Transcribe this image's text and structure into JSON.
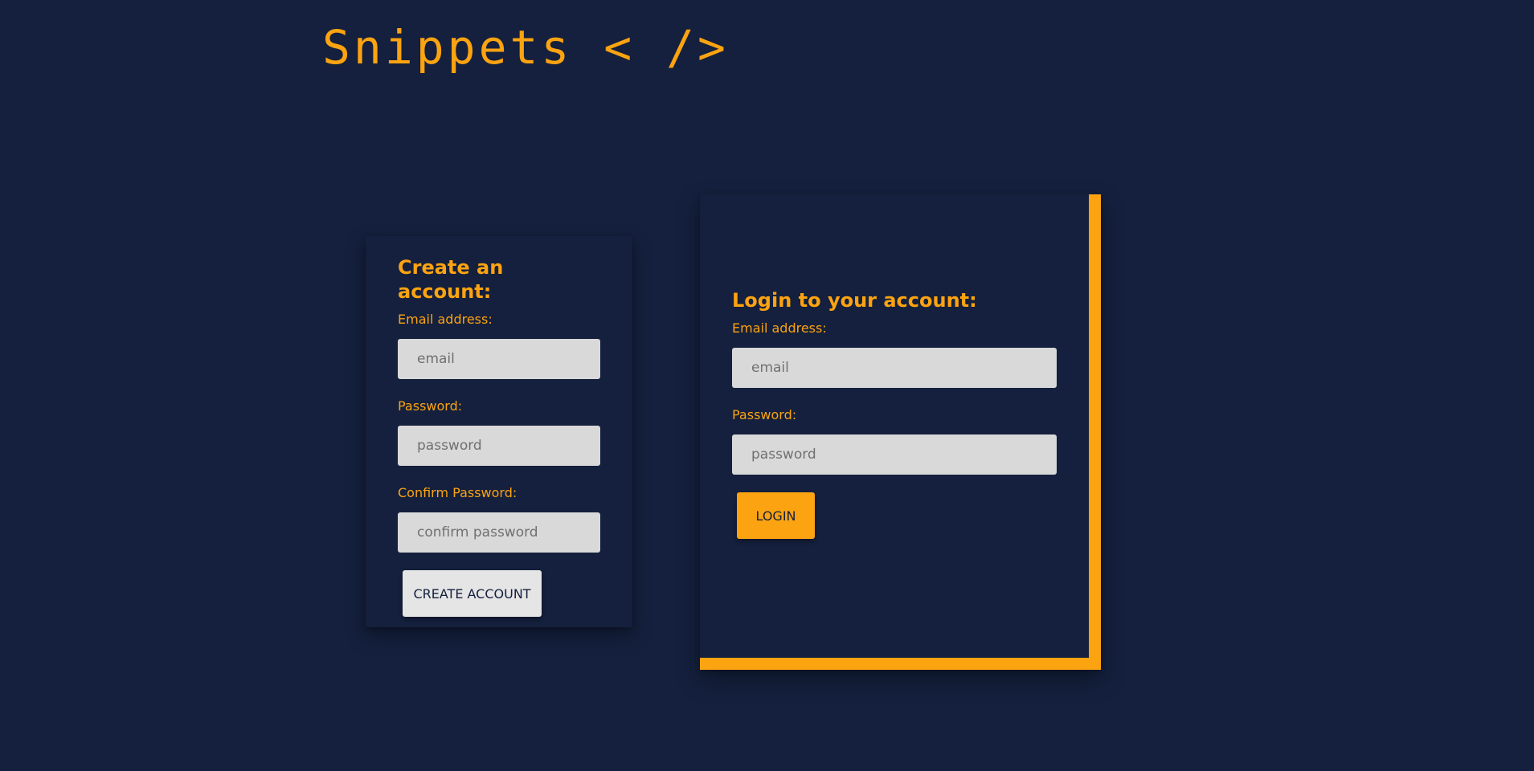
{
  "brand": {
    "logo_text": "Snippets < />"
  },
  "signup": {
    "title": "Create an account:",
    "email_label": "Email address:",
    "email_placeholder": "email",
    "password_label": "Password:",
    "password_placeholder": "password",
    "confirm_label": "Confirm Password:",
    "confirm_placeholder": "confirm password",
    "submit_label": "CREATE ACCOUNT"
  },
  "login": {
    "title": "Login to your account:",
    "email_label": "Email address:",
    "email_placeholder": "email",
    "password_label": "Password:",
    "password_placeholder": "password",
    "submit_label": "LOGIN"
  },
  "colors": {
    "background": "#14203d",
    "accent": "#fca311",
    "input_bg": "#d9d9d9"
  }
}
